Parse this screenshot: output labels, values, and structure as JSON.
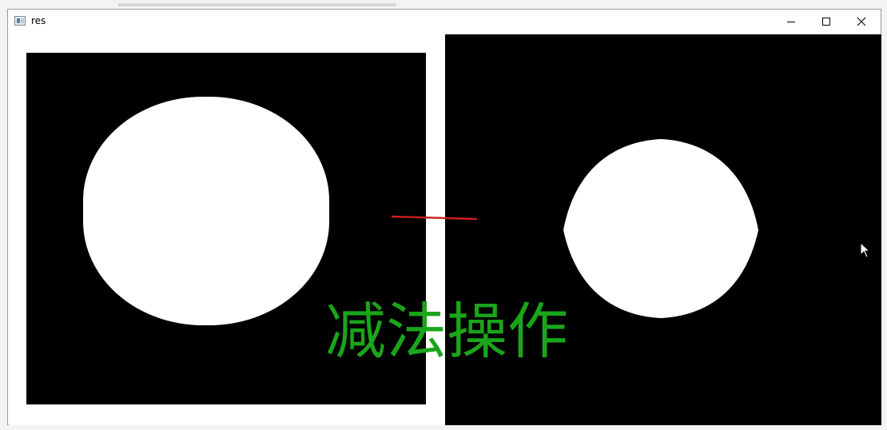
{
  "window": {
    "title": "res",
    "controls": {
      "minimize_icon": "minimize-icon",
      "maximize_icon": "maximize-icon",
      "close_icon": "close-icon"
    }
  },
  "image": {
    "overlay_text": "减法操作",
    "overlay_color": "#1aa51a",
    "annotation_line_color": "#cc1f1f"
  },
  "cursor": {
    "icon": "mouse-pointer-icon"
  }
}
